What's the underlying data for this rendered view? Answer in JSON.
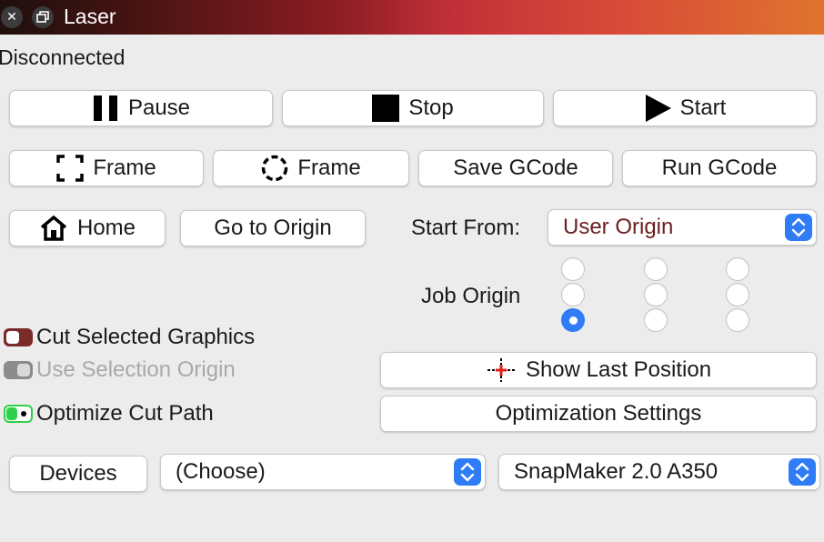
{
  "window": {
    "title": "Laser"
  },
  "status": "Disconnected",
  "controls": {
    "pause": "Pause",
    "stop": "Stop",
    "start": "Start"
  },
  "frame": {
    "frame_rect": "Frame",
    "frame_circle": "Frame",
    "save_gcode": "Save GCode",
    "run_gcode": "Run GCode"
  },
  "nav": {
    "home": "Home",
    "go_to_origin": "Go to Origin"
  },
  "start_from": {
    "label": "Start From:",
    "value": "User Origin",
    "value_color": "#6b1f1f"
  },
  "job_origin": {
    "label": "Job Origin",
    "selected_row": 2,
    "selected_col": 0
  },
  "options": {
    "cut_selected_graphics": {
      "label": "Cut Selected Graphics",
      "state": "on",
      "color": "#7b2a2a"
    },
    "use_selection_origin": {
      "label": "Use Selection Origin",
      "state": "disabled",
      "color": "#8c8c8c"
    },
    "optimize_cut_path": {
      "label": "Optimize Cut Path",
      "state": "on",
      "color": "#2fd04a"
    }
  },
  "actions": {
    "show_last_position": "Show Last Position",
    "optimization_settings": "Optimization Settings"
  },
  "devices": {
    "button": "Devices",
    "port_value": "(Choose)",
    "device_value": "SnapMaker 2.0 A350"
  },
  "colors": {
    "accent": "#2f7cf6",
    "crosshair": "#e02020"
  }
}
